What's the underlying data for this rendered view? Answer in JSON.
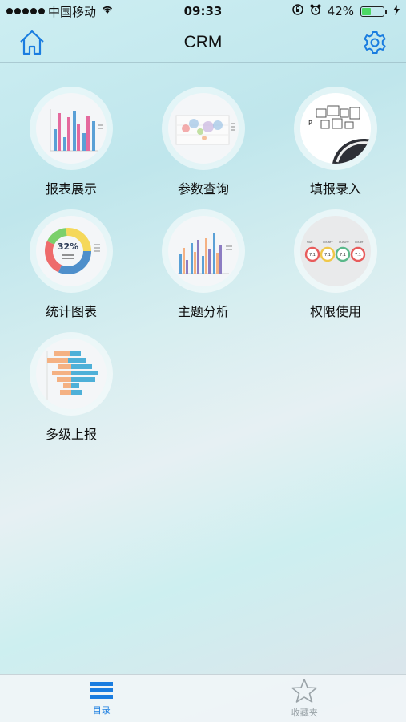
{
  "status_bar": {
    "carrier": "中国移动",
    "time": "09:33",
    "battery": "42%",
    "battery_level": 0.42
  },
  "nav": {
    "title": "CRM",
    "home_icon": "home-icon",
    "settings_icon": "gear-icon"
  },
  "menu": [
    {
      "label": "报表展示",
      "icon": "bar-chart-icon"
    },
    {
      "label": "参数查询",
      "icon": "bubble-chart-icon"
    },
    {
      "label": "填报录入",
      "icon": "form-grid-icon"
    },
    {
      "label": "统计图表",
      "icon": "donut-chart-icon"
    },
    {
      "label": "主题分析",
      "icon": "column-chart-icon"
    },
    {
      "label": "权限使用",
      "icon": "gauge-icon"
    },
    {
      "label": "多级上报",
      "icon": "horizontal-bar-icon"
    }
  ],
  "donut_text": "32%",
  "tabs": [
    {
      "label": "目录",
      "icon": "list-icon",
      "active": true
    },
    {
      "label": "收藏夹",
      "icon": "star-icon",
      "active": false
    }
  ],
  "colors": {
    "accent": "#1a7de0",
    "battery": "#4cd964"
  }
}
